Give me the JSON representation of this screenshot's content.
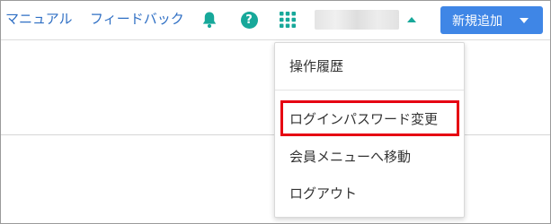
{
  "header": {
    "links": {
      "manual": "マニュアル",
      "feedback": "フィードバック"
    },
    "icons": {
      "notifications": "bell-icon",
      "help": "help-circle-icon",
      "apps": "apps-grid-icon",
      "help_glyph": "?"
    },
    "new_button_label": "新規追加"
  },
  "dropdown": {
    "items": [
      {
        "label": "操作履歴"
      },
      {
        "label": "ログインパスワード変更",
        "highlighted": true
      },
      {
        "label": "会員メニューへ移動"
      },
      {
        "label": "ログアウト"
      }
    ]
  },
  "colors": {
    "link": "#2f6fc4",
    "accent_teal": "#17a89a",
    "primary_button": "#3f86e6",
    "highlight_border": "#e60012"
  }
}
